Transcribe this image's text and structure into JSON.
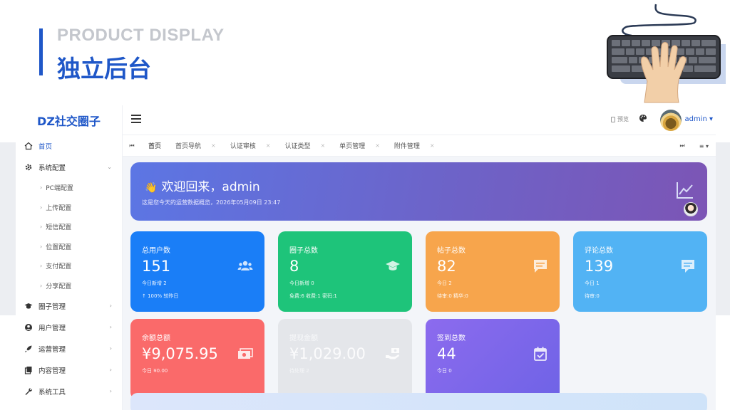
{
  "slide": {
    "kicker": "PRODUCT DISPLAY",
    "title": "独立后台"
  },
  "app": {
    "logo": "DZ社交圈子",
    "admin_label": "admin ▾",
    "preview_label": "预览"
  },
  "sidebar": {
    "items": [
      {
        "label": "首页",
        "icon": "home-icon"
      },
      {
        "label": "系统配置",
        "icon": "gear-icon",
        "caret": "⌄"
      },
      {
        "label": "圈子管理",
        "icon": "graduation-cap-icon",
        "caret": "›"
      },
      {
        "label": "用户管理",
        "icon": "user-circle-icon",
        "caret": "›"
      },
      {
        "label": "运营管理",
        "icon": "rocket-icon",
        "caret": "›"
      },
      {
        "label": "内容管理",
        "icon": "copy-icon",
        "caret": "›"
      },
      {
        "label": "系统工具",
        "icon": "wrench-icon",
        "caret": "›"
      }
    ],
    "sub_items": [
      {
        "label": "PC端配置"
      },
      {
        "label": "上传配置"
      },
      {
        "label": "短信配置"
      },
      {
        "label": "位置配置"
      },
      {
        "label": "支付配置"
      },
      {
        "label": "分享配置"
      }
    ]
  },
  "tabs": {
    "first_btn": "⏮",
    "last_btn": "⏭",
    "menu_btn": "≡ ▾",
    "items": [
      {
        "label": "首页"
      },
      {
        "label": "首页导航",
        "close": "×"
      },
      {
        "label": "认证审核",
        "close": "×"
      },
      {
        "label": "认证类型",
        "close": "×"
      },
      {
        "label": "单页管理",
        "close": "×"
      },
      {
        "label": "附件管理",
        "close": "×"
      }
    ]
  },
  "welcome": {
    "wave": "👋",
    "title": "欢迎回来，admin",
    "subtitle": "这是您今天的运营数据概览，2026年05月09日 23:47"
  },
  "cards": [
    {
      "label": "总用户数",
      "value": "151",
      "line1": "今日新增 2",
      "line2": "↑ 100% 较昨日",
      "color": "#1a7ef7",
      "icon": "users-icon"
    },
    {
      "label": "圈子总数",
      "value": "8",
      "line1": "今日新增 0",
      "line2": "免费:6 收费:1 密码:1",
      "color": "#1ec47a",
      "icon": "graduation-cap-icon"
    },
    {
      "label": "帖子总数",
      "value": "82",
      "line1": "今日 2",
      "line2": "待审:0 精华:0",
      "color": "#f7a54c",
      "icon": "comment-icon"
    },
    {
      "label": "评论总数",
      "value": "139",
      "line1": "今日 1",
      "line2": "待审:0",
      "color": "#52b3f4",
      "icon": "comment-alt-icon"
    },
    {
      "label": "余额总额",
      "value": "¥9,075.95",
      "line1": "今日 ¥0.00",
      "line2": "",
      "color": "#fa6a6a",
      "icon": "money-bill-icon"
    },
    {
      "label": "提现金额",
      "value": "¥1,029.00",
      "line1": "待处理 2",
      "line2": "",
      "color": "#e4e6ea",
      "icon": "hand-money-icon"
    },
    {
      "label": "签到总数",
      "value": "44",
      "line1": "今日 0",
      "line2": "",
      "color": "#8c6bee",
      "icon": "calendar-check-icon"
    }
  ]
}
